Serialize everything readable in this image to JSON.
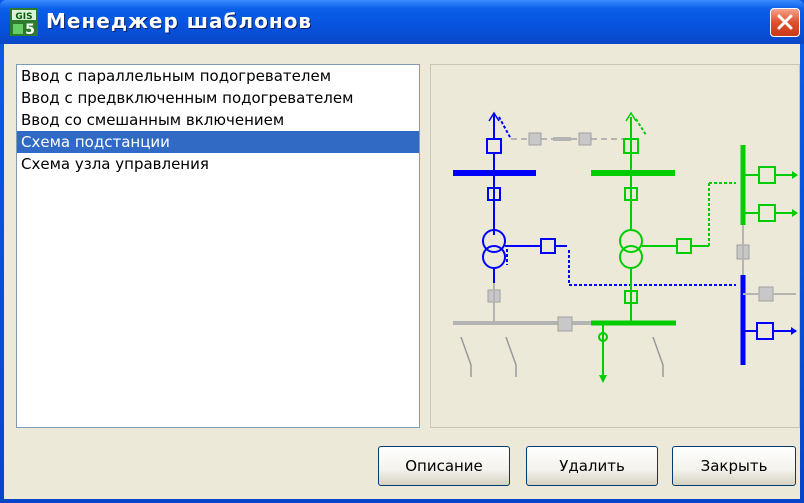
{
  "window": {
    "title": "Менеджер шаблонов",
    "app_icon": "gis-app-icon",
    "close_icon": "close-icon"
  },
  "templates": {
    "items": [
      {
        "label": "Ввод с параллельным подогревателем"
      },
      {
        "label": "Ввод с предвключенным подогревателем"
      },
      {
        "label": "Ввод со смешанным включением"
      },
      {
        "label": "Схема подстанции",
        "selected": true
      },
      {
        "label": "Схема узла управления"
      }
    ]
  },
  "buttons": {
    "describe": "Описание",
    "delete": "Удалить",
    "close": "Закрыть"
  },
  "colors": {
    "blue": "#0000ff",
    "green": "#00cc00",
    "gray": "#b4b4b4",
    "selection": "#316ac5"
  }
}
